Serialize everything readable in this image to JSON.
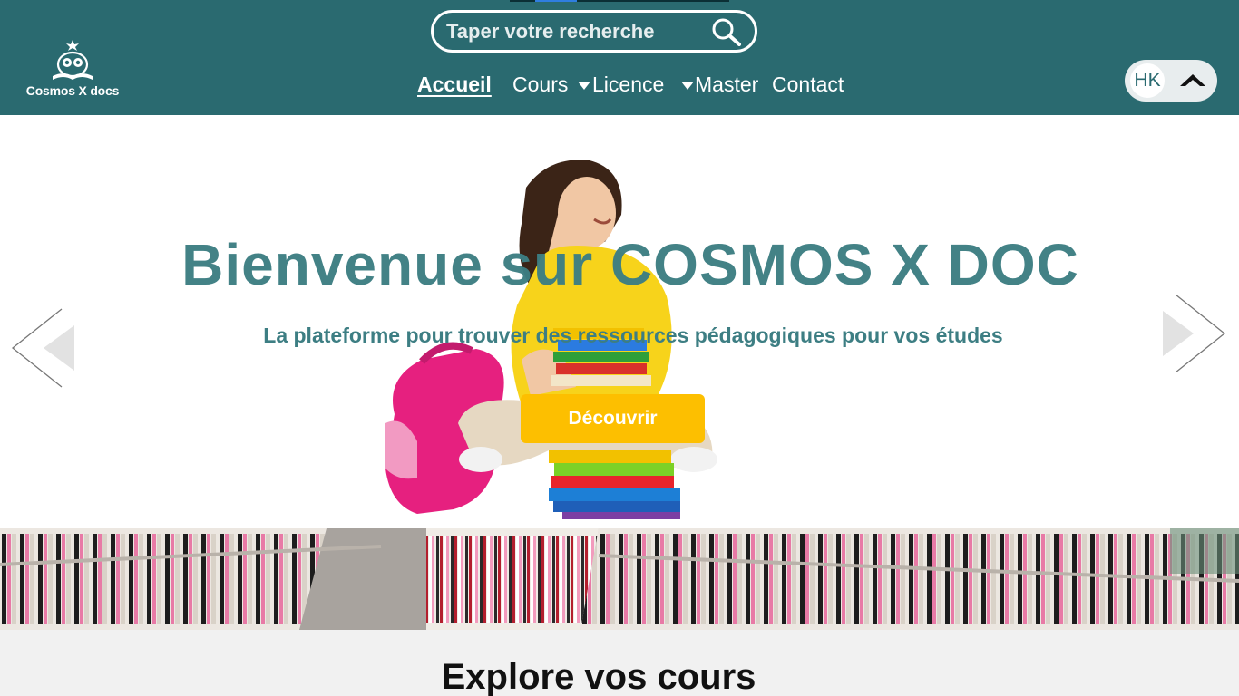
{
  "header": {
    "logo_text": "Cosmos X docs",
    "search": {
      "placeholder": "Taper votre recherche",
      "icon": "search-icon"
    },
    "nav": {
      "home": "Accueil",
      "courses": "Cours",
      "license": "Licence",
      "master": "Master",
      "contact": "Contact"
    },
    "user": {
      "initials": "HK",
      "toggle_icon": "chevron-up-icon"
    }
  },
  "hero": {
    "title": "Bienvenue sur COSMOS X DOC",
    "subtitle": "La  plateforme pour trouver des ressources pédagogiques pour vos études",
    "cta_label": "Découvrir",
    "prev_icon": "chevron-left-icon",
    "next_icon": "chevron-right-icon"
  },
  "explore": {
    "title": "Explore vos cours"
  },
  "colors": {
    "header_bg": "#2a6a70",
    "title_teal": "#3d7e83",
    "cta_yellow": "#fdbf00",
    "explore_bg": "#f1f1f1"
  }
}
